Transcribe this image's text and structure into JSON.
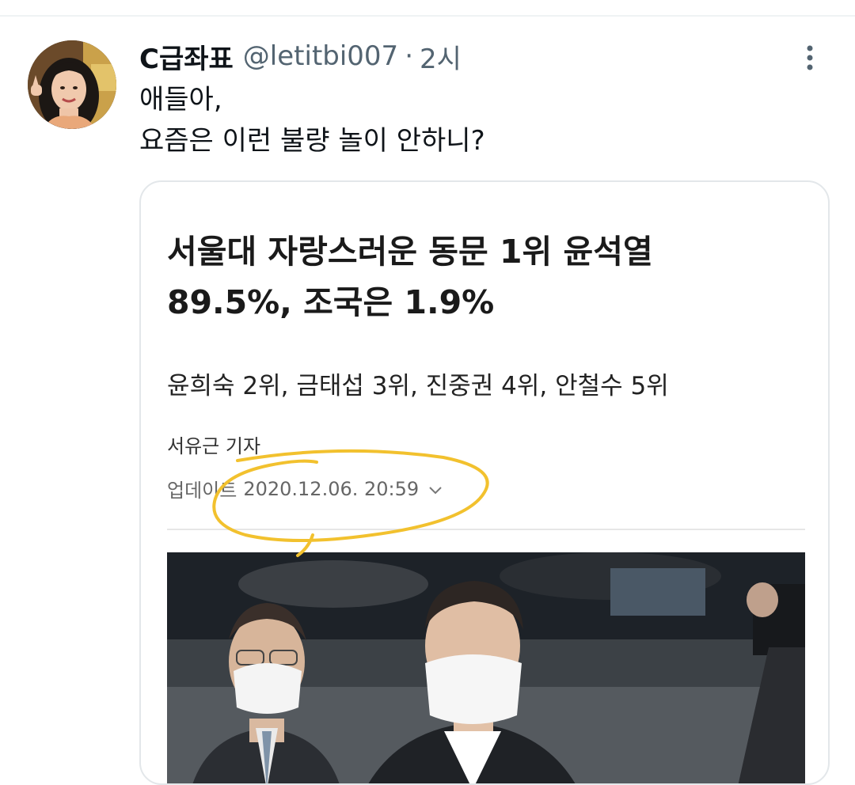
{
  "tweet": {
    "display_name": "C급좌표",
    "handle": "@letitbi007",
    "separator": "·",
    "time": "2시",
    "text_lines": [
      "애들아,",
      "요즘은 이런 불량 놀이 안하니?"
    ]
  },
  "icons": {
    "more": "more-vertical-icon",
    "chevron": "chevron-down-icon"
  },
  "card": {
    "headline_lines": [
      "서울대 자랑스러운 동문 1위 윤석열",
      "89.5%, 조국은 1.9%"
    ],
    "subheadline": "윤희숙 2위, 금태섭 3위, 진중권 4위, 안철수 5위",
    "reporter": "서유근 기자",
    "update_label": "업데이트",
    "update_time": "2020.12.06. 20:59"
  },
  "colors": {
    "highlight": "#f2c12e",
    "muted": "#536471",
    "divider": "#eff3f4"
  }
}
